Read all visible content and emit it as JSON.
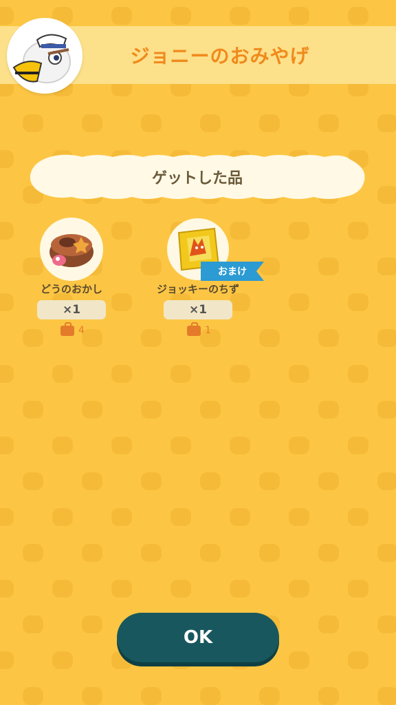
{
  "header": {
    "title": "ジョニーのおみやげ"
  },
  "section": {
    "title": "ゲットした品"
  },
  "items": [
    {
      "name": "どうのおかし",
      "quantity": "×1",
      "owned": "4"
    },
    {
      "name": "ジョッキーのちず",
      "quantity": "×1",
      "owned": "1",
      "badge": "おまけ"
    }
  ],
  "actions": {
    "ok_label": "OK"
  },
  "colors": {
    "background": "#fcc644",
    "title": "#f08a1c",
    "button": "#18575e",
    "badge": "#2c9ad3",
    "bag_icon": "#e47b2a"
  }
}
